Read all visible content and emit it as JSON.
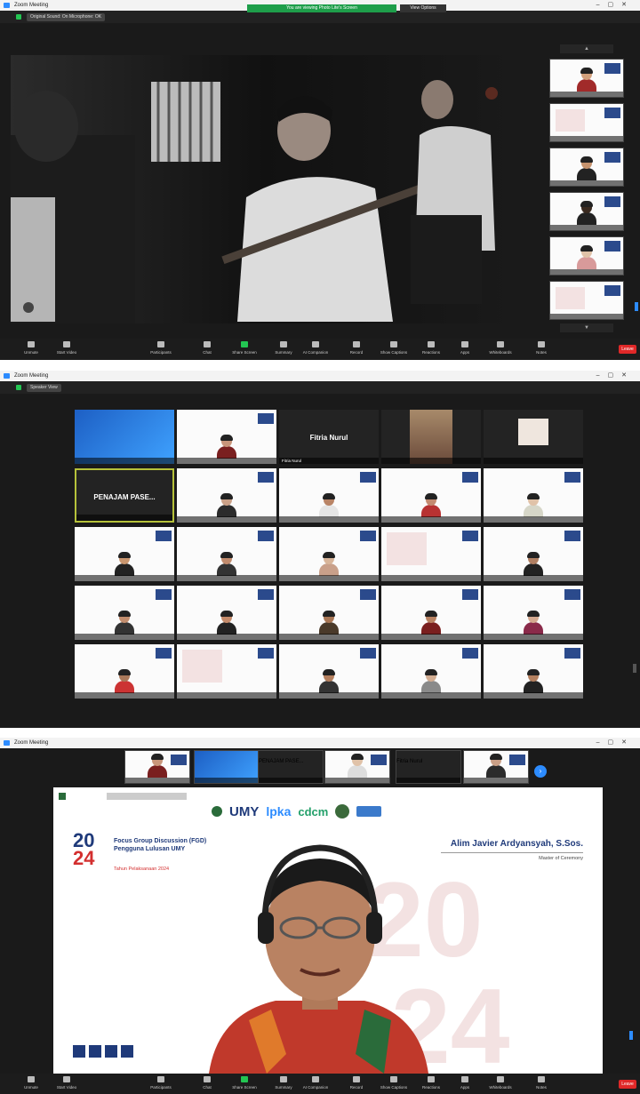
{
  "window_title": "Zoom Meeting",
  "topbar": {
    "view_label": "Original Sound: On  Microphone: OK"
  },
  "panel1": {
    "recording_notice": "You are viewing Photo Lite's Screen",
    "view_options": "View Options",
    "thumbs": [
      {
        "name": "",
        "kind": "person",
        "skin": "#d2a07c",
        "shirt": "#a12a2a"
      },
      {
        "name": "",
        "kind": "slide"
      },
      {
        "name": "",
        "kind": "person",
        "skin": "#c6936e",
        "shirt": "#222"
      },
      {
        "name": "",
        "kind": "person",
        "skin": "#3a2a20",
        "shirt": "#222"
      },
      {
        "name": "",
        "kind": "person",
        "skin": "#e0c2a8",
        "shirt": "#d89a9a"
      },
      {
        "name": "",
        "kind": "slide"
      }
    ]
  },
  "panel2": {
    "view_label": "Speaker View",
    "tiles": [
      {
        "name": "",
        "kind": "screen"
      },
      {
        "name": "",
        "kind": "person",
        "skin": "#c8957a",
        "shirt": "#7a1f1f"
      },
      {
        "name": "Fitria Nurul",
        "kind": "dark-name",
        "big": "Fitria Nurul"
      },
      {
        "name": "",
        "kind": "photo"
      },
      {
        "name": "",
        "kind": "dark-small"
      },
      {
        "name": "",
        "kind": "dark-name",
        "big": "PENAJAM PASE...",
        "active": true
      },
      {
        "name": "",
        "kind": "person",
        "skin": "#caa087",
        "shirt": "#2b2b2b"
      },
      {
        "name": "",
        "kind": "person",
        "skin": "#b98466",
        "shirt": "#e5e5e5"
      },
      {
        "name": "",
        "kind": "person",
        "skin": "#c48a70",
        "shirt": "#b83232"
      },
      {
        "name": "",
        "kind": "person",
        "skin": "#e0c2a8",
        "shirt": "#d6d6c8"
      },
      {
        "name": "",
        "kind": "person",
        "skin": "#c9966f",
        "shirt": "#222"
      },
      {
        "name": "",
        "kind": "person",
        "skin": "#c18b6d",
        "shirt": "#333"
      },
      {
        "name": "",
        "kind": "person",
        "skin": "#d8b59a",
        "shirt": "#c9a08a"
      },
      {
        "name": "",
        "kind": "slide"
      },
      {
        "name": "",
        "kind": "person",
        "skin": "#b07f62",
        "shirt": "#222"
      },
      {
        "name": "",
        "kind": "person",
        "skin": "#c28d6e",
        "shirt": "#333"
      },
      {
        "name": "",
        "kind": "person",
        "skin": "#c48a6a",
        "shirt": "#222"
      },
      {
        "name": "",
        "kind": "person",
        "skin": "#a97655",
        "shirt": "#4a3a2a"
      },
      {
        "name": "",
        "kind": "person",
        "skin": "#b88262",
        "shirt": "#7a1f1f"
      },
      {
        "name": "",
        "kind": "person",
        "skin": "#d4a990",
        "shirt": "#8a2a4a"
      },
      {
        "name": "",
        "kind": "person",
        "skin": "#a9785a",
        "shirt": "#c33"
      },
      {
        "name": "",
        "kind": "slide"
      },
      {
        "name": "",
        "kind": "person",
        "skin": "#b47f5e",
        "shirt": "#333"
      },
      {
        "name": "",
        "kind": "person",
        "skin": "#d2ad92",
        "shirt": "#8a8a8a"
      },
      {
        "name": "",
        "kind": "person",
        "skin": "#b4805f",
        "shirt": "#222"
      }
    ]
  },
  "panel3": {
    "strip": [
      {
        "name": "",
        "kind": "person",
        "skin": "#c8957a",
        "shirt": "#7a1f1f"
      },
      {
        "name": "",
        "kind": "screen"
      },
      {
        "name": "",
        "kind": "dark-name",
        "big": "PENAJAM PASE..."
      },
      {
        "name": "",
        "kind": "person",
        "skin": "#e0c2a8",
        "shirt": "#ddd"
      },
      {
        "name": "",
        "kind": "dark-name",
        "big": "Fitria Nurul"
      },
      {
        "name": "",
        "kind": "person",
        "skin": "#caa087",
        "shirt": "#2b2b2b"
      }
    ],
    "slide": {
      "logos": [
        "UMY",
        "lpka",
        "cdcm"
      ],
      "year_top": "20",
      "year_bottom": "24",
      "headline": "Focus Group Discussion (FGD) Pengguna Lulusan UMY",
      "sub": "Tahun Pelaksanaan 2024",
      "speaker_name": "Alim Javier Ardyansyah, S.Sos.",
      "speaker_role": "Master of Ceremony"
    }
  },
  "toolbar": {
    "items": [
      "Unmute",
      "Start Video",
      "Participants",
      "Chat",
      "Share Screen",
      "Summary",
      "AI Companion",
      "Record",
      "Show Captions",
      "Reactions",
      "Apps",
      "Whiteboards",
      "Notes"
    ],
    "leave": "Leave"
  },
  "colors": {
    "zoom_blue": "#2d8cff",
    "share_green": "#23c552",
    "leave_red": "#e02828",
    "brand_navy": "#1f3a7a",
    "brand_red": "#d32f2f"
  }
}
